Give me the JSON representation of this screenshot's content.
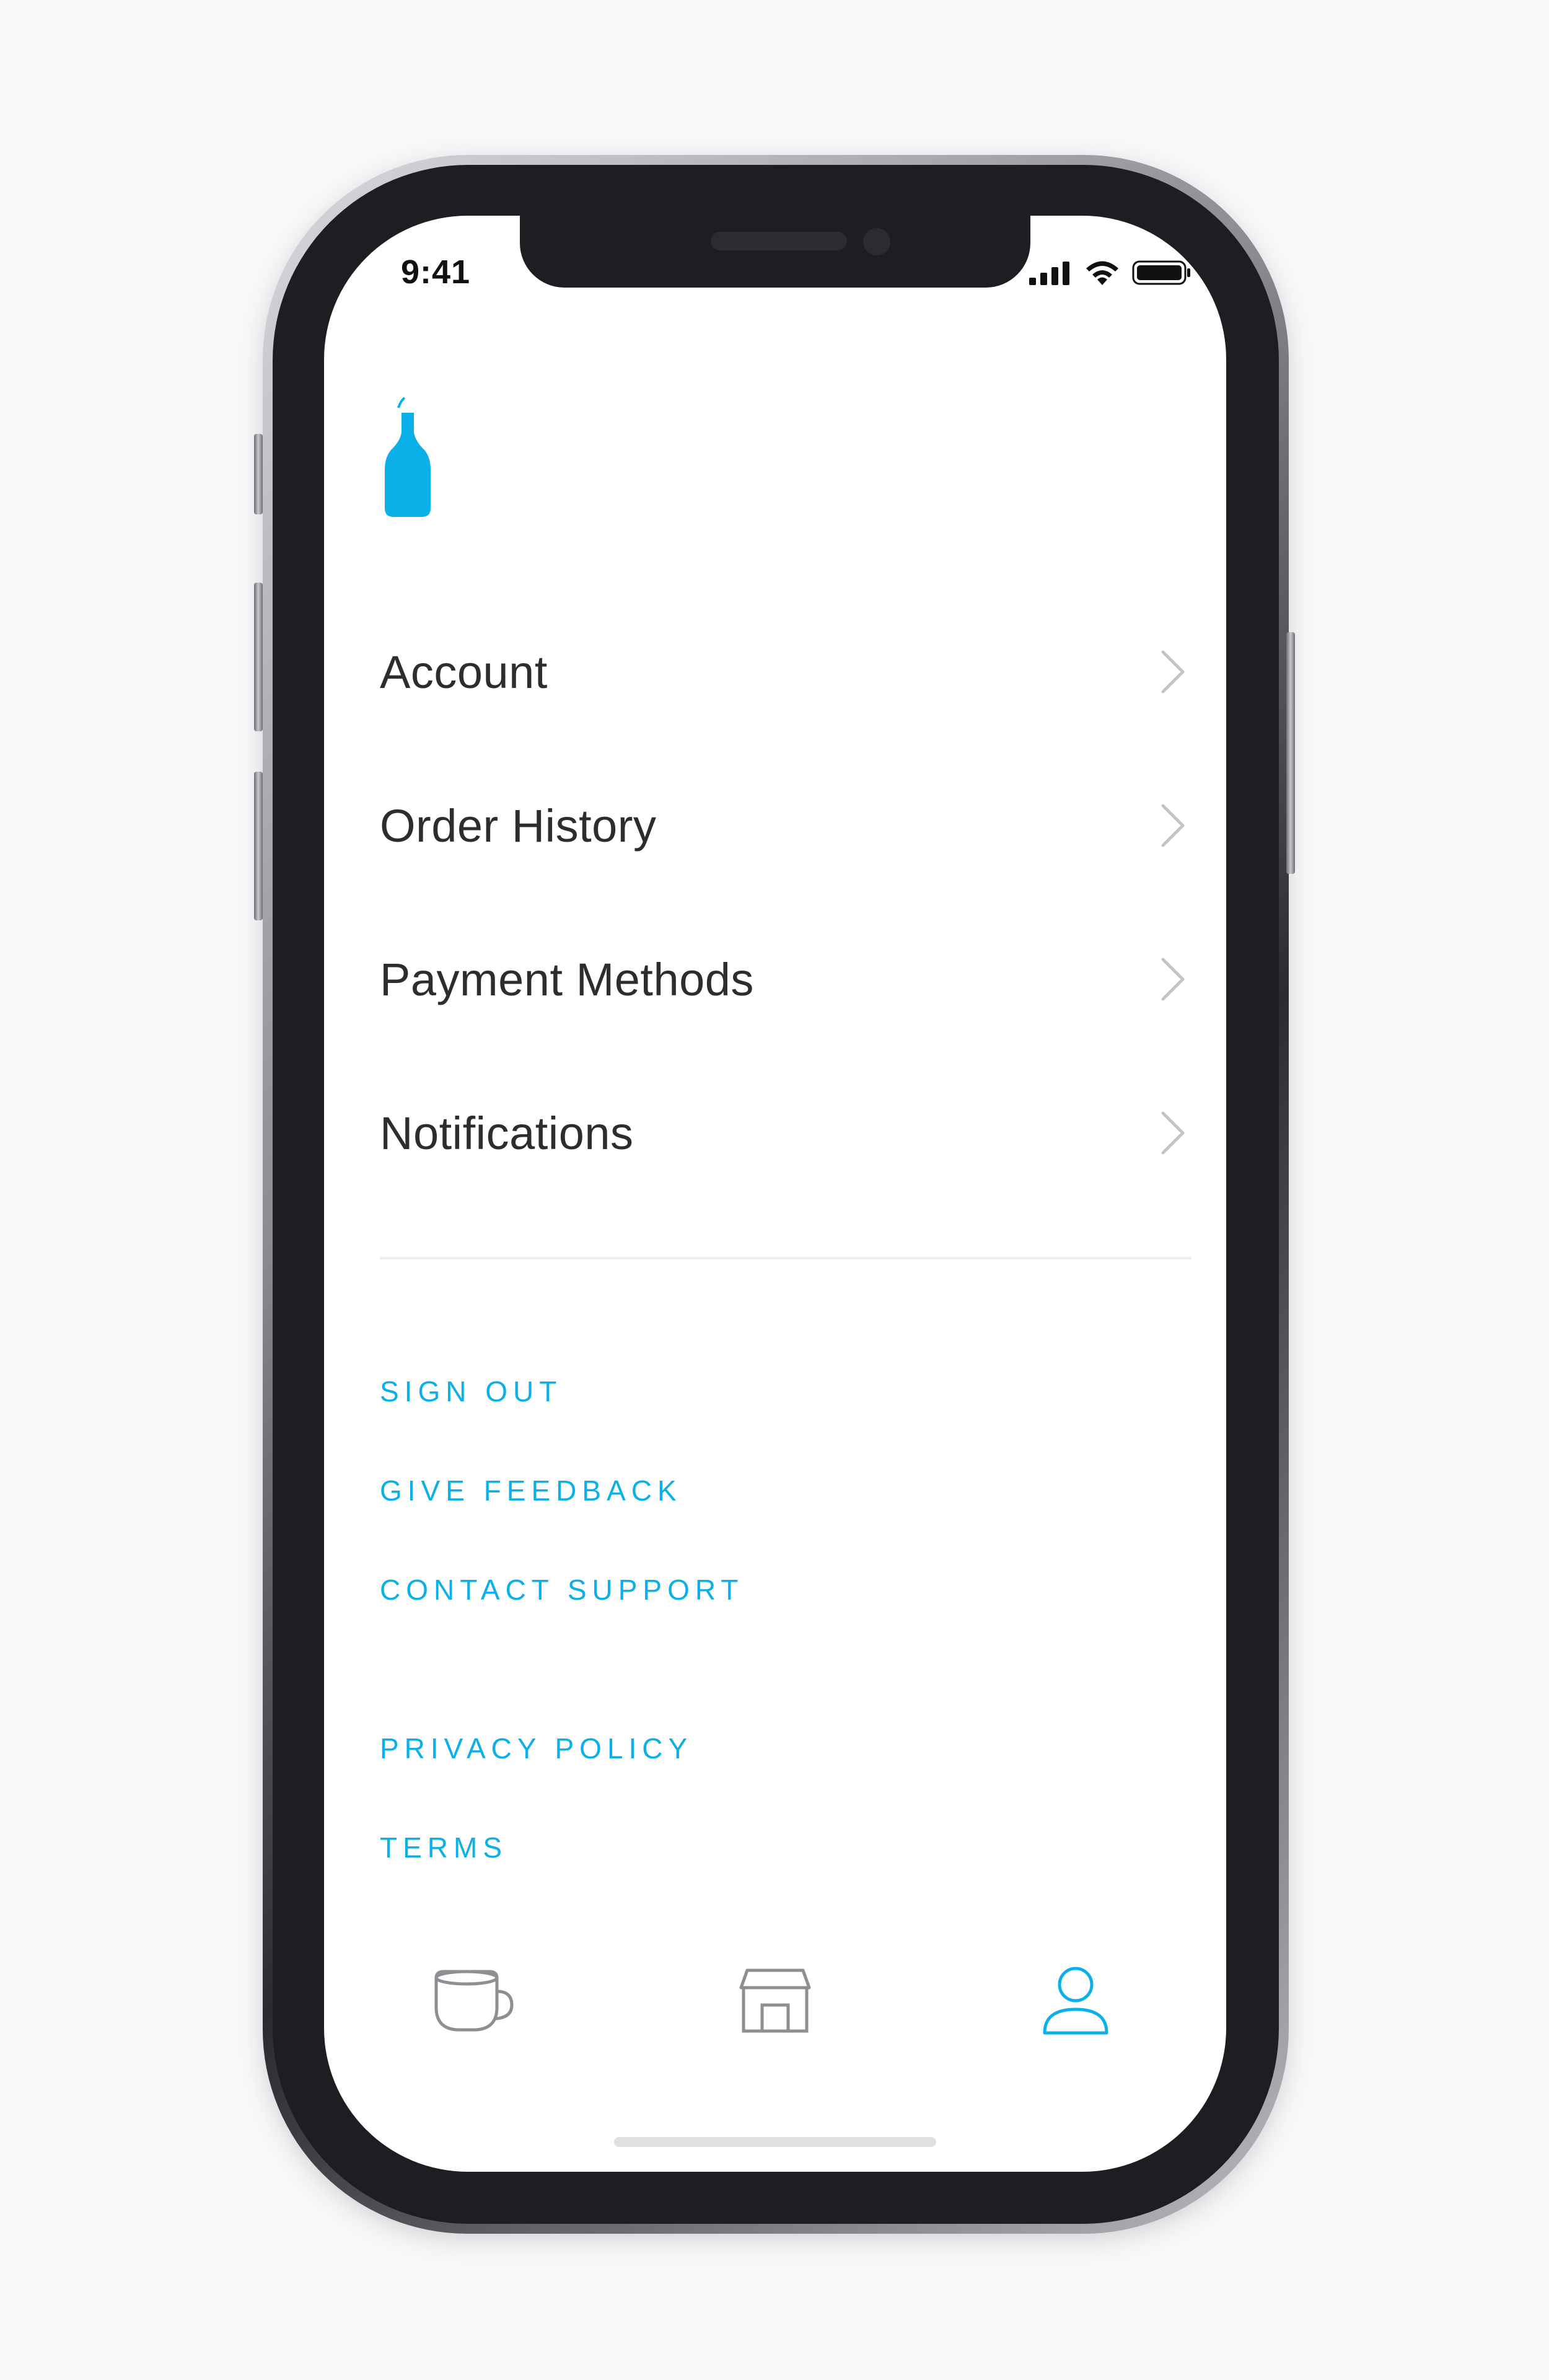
{
  "status_bar": {
    "time": "9:41",
    "icons": [
      "signal-icon",
      "wifi-icon",
      "battery-icon"
    ]
  },
  "brand": {
    "logo_icon": "bottle-logo-icon",
    "color": "#0bb0e8"
  },
  "menu": {
    "items": [
      {
        "label": "Account",
        "icon": "chevron-right-icon"
      },
      {
        "label": "Order History",
        "icon": "chevron-right-icon"
      },
      {
        "label": "Payment Methods",
        "icon": "chevron-right-icon"
      },
      {
        "label": "Notifications",
        "icon": "chevron-right-icon"
      }
    ]
  },
  "links": {
    "sign_out": "SIGN OUT",
    "give_feedback": "GIVE FEEDBACK",
    "contact_support": "CONTACT SUPPORT",
    "privacy_policy": "PRIVACY POLICY",
    "terms": "TERMS"
  },
  "tab_bar": {
    "tabs": [
      {
        "icon": "cup-icon",
        "active": false
      },
      {
        "icon": "store-icon",
        "active": false
      },
      {
        "icon": "profile-icon",
        "active": true
      }
    ],
    "active_color": "#0bb0e8",
    "inactive_color": "#8e8e93"
  }
}
